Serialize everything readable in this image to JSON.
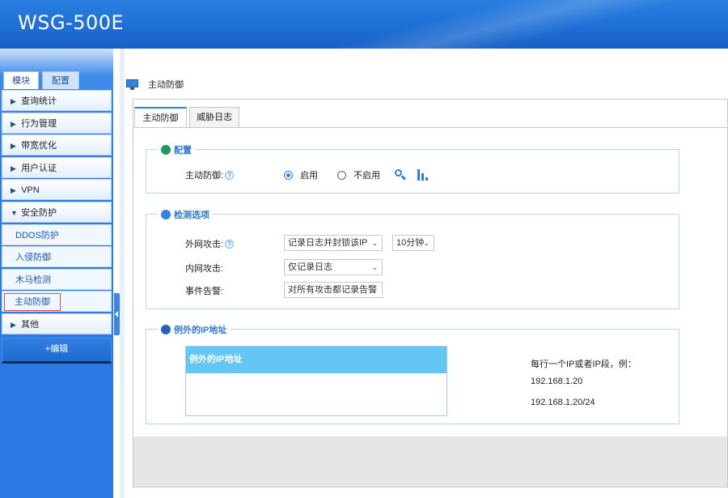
{
  "header": {
    "product_name": "WSG-500E"
  },
  "sidebar": {
    "tabs": [
      "模块",
      "配置"
    ],
    "menu": [
      {
        "label": "查询统计",
        "expanded": false
      },
      {
        "label": "行为管理",
        "expanded": false
      },
      {
        "label": "带宽优化",
        "expanded": false
      },
      {
        "label": "用户认证",
        "expanded": false
      },
      {
        "label": "VPN",
        "expanded": false
      },
      {
        "label": "安全防护",
        "expanded": true
      }
    ],
    "submenu": [
      "DDOS防护",
      "入侵防御",
      "木马检测",
      "主动防御"
    ],
    "active_submenu": "主动防御",
    "other_label": "其他",
    "edit_label": "+编辑"
  },
  "page": {
    "title": "主动防御",
    "tabs": [
      "主动防御",
      "威胁日志"
    ],
    "config_section": {
      "legend": "配置",
      "label": "主动防御:",
      "options": [
        "启用",
        "不启用"
      ],
      "selected": "启用"
    },
    "detection_section": {
      "legend": "检测选项",
      "external_label": "外网攻击:",
      "external_action": "记录日志并封锁该IP",
      "external_duration": "10分钟",
      "internal_label": "内网攻击:",
      "internal_action": "仅记录日志",
      "alert_label": "事件告警:",
      "alert_action": "对所有攻击都记录告警"
    },
    "exception_section": {
      "legend": "例外的IP地址",
      "table_header": "例外的IP地址",
      "hint": "每行一个IP或者IP段，例：",
      "example1": "192.168.1.20",
      "example2": "192.168.1.20/24"
    }
  },
  "colors": {
    "header_blue": "#1e6fd6",
    "accent_blue": "#2e7fe0",
    "table_header": "#64c6f2",
    "active_outline": "#e24b4b"
  }
}
